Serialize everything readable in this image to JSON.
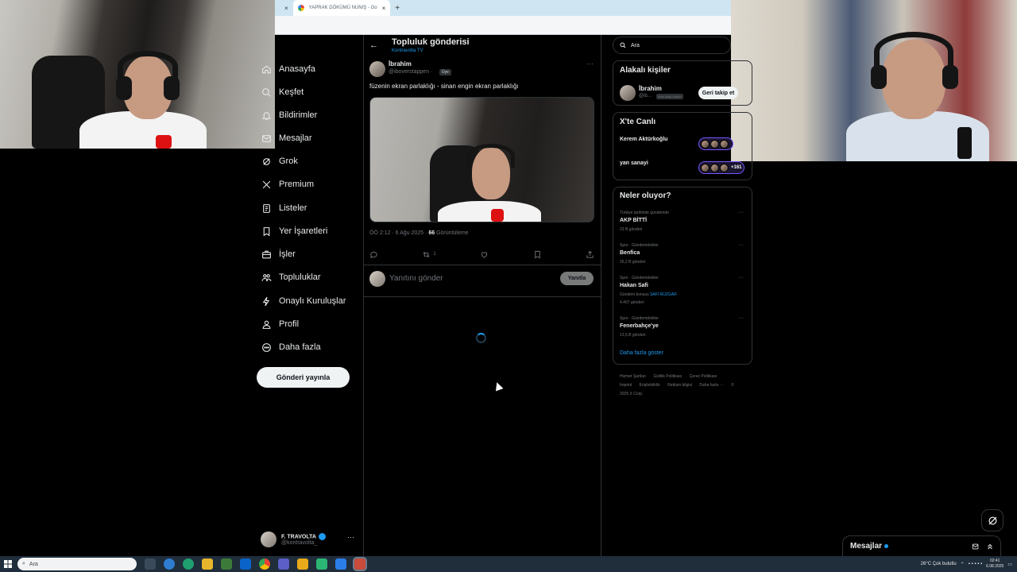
{
  "browser": {
    "tabs": [
      {
        "label": "",
        "active": false
      },
      {
        "label": "YAPRAK DÖKÜMÜ NUNIŞ - Go",
        "active": true
      }
    ]
  },
  "nav": {
    "items": [
      {
        "label": "Anasayfa",
        "icon": "home-icon"
      },
      {
        "label": "Keşfet",
        "icon": "explore-icon"
      },
      {
        "label": "Bildirimler",
        "icon": "bell-icon"
      },
      {
        "label": "Mesajlar",
        "icon": "mail-icon"
      },
      {
        "label": "Grok",
        "icon": "grok-icon"
      },
      {
        "label": "Premium",
        "icon": "x-logo-icon"
      },
      {
        "label": "Listeler",
        "icon": "list-icon"
      },
      {
        "label": "Yer İşaretleri",
        "icon": "bookmark-icon"
      },
      {
        "label": "İşler",
        "icon": "briefcase-icon"
      },
      {
        "label": "Topluluklar",
        "icon": "communities-icon"
      },
      {
        "label": "Onaylı Kuruluşlar",
        "icon": "lightning-icon"
      },
      {
        "label": "Profil",
        "icon": "person-icon"
      },
      {
        "label": "Daha fazla",
        "icon": "more-circle-icon"
      }
    ],
    "post_button": "Gönderi yayınla",
    "account": {
      "name": "F. TRAVOLTA",
      "handle": "@kontravolta_"
    }
  },
  "header": {
    "title": "Topluluk gönderisi",
    "community": "Kontravolta TV"
  },
  "tweet": {
    "author": "İbrahim",
    "handle": "@iboverstappen ·",
    "badge": "Üye",
    "text": "füzenin ekran parlaklığı - sinan engin ekran parlaklığı",
    "timestamp": "ÖÖ 2:12 · 6 Ağu 2025 ·",
    "views_count": "66",
    "views_label": "Görüntüleme",
    "retweets": "1"
  },
  "reply": {
    "placeholder": "Yanıtını gönder",
    "button": "Yanıtla"
  },
  "search": {
    "placeholder": "Ara"
  },
  "relevant_people": {
    "title": "Alakalı kişiler",
    "person": {
      "name": "İbrahim",
      "handle": "@ib...",
      "badge": "Seni takip ediyor"
    },
    "follow_button": "Geri takip et"
  },
  "live": {
    "title": "X'te Canlı",
    "items": [
      {
        "name": "Kerem Aktürkoğlu",
        "count": ""
      },
      {
        "name": "yan sanayi",
        "count": "+161"
      }
    ]
  },
  "trends": {
    "title": "Neler oluyor?",
    "items": [
      {
        "context": "Türkiye tarihinde gündemde",
        "title": "AKP BİTTİ",
        "count": "23 B gönderi",
        "extra": ""
      },
      {
        "context": "Spor · Gündemdekiler",
        "title": "Benfica",
        "count": "26,2 B gönderi",
        "extra": ""
      },
      {
        "context": "Spor · Gündemdekiler",
        "title": "Hakan Safi",
        "count": "4.407 gönderi",
        "extra_prefix": "Gündem konusu",
        "extra": "SAFİ RÜZGAR"
      },
      {
        "context": "Spor · Gündemdekiler",
        "title": "Fenerbahçe'ye",
        "count": "13,5 B gönderi",
        "extra": ""
      }
    ],
    "show_more": "Daha fazla göster"
  },
  "footer": {
    "links": [
      "Hizmet Şartları",
      "Gizlilik Politikası",
      "Çerez Politikası",
      "İmprint",
      "Erişilebilirlik",
      "Reklam bilgisi",
      "Daha fazla ···",
      "© 2025 X Corp."
    ]
  },
  "messages": {
    "title": "Mesajlar"
  },
  "taskbar": {
    "search_placeholder": "Ara",
    "weather": "26°C  Çok bulutlu",
    "time": "02:41",
    "date": "6.08.2025"
  },
  "colors": {
    "accent": "#1d9bf0",
    "background": "#000000",
    "border": "#2f3336",
    "muted_text": "#71767b"
  }
}
